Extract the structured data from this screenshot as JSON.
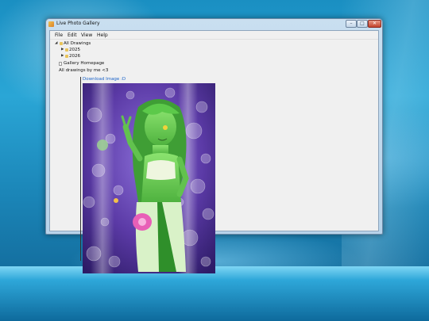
{
  "window": {
    "title": "Live Photo Gallery",
    "controls": {
      "minimize": "–",
      "maximize": "□",
      "close": "✕"
    }
  },
  "menu": {
    "items": [
      "File",
      "Edit",
      "View",
      "Help"
    ]
  },
  "tree": {
    "root": {
      "label": "All Drawings",
      "expanded": true
    },
    "children": [
      {
        "label": "2025",
        "expanded": false
      },
      {
        "label": "2026",
        "expanded": false
      }
    ],
    "homepage": "Gallery Homepage",
    "caption": "All drawings by me <3"
  },
  "viewer": {
    "download_label": "Download Image :D"
  },
  "colors": {
    "link": "#1a63c9",
    "folder": "#e8c35a",
    "artwork_bg": "#5b3aa6",
    "character_skin": "#6fd35a",
    "flower": "#e85fb7"
  }
}
